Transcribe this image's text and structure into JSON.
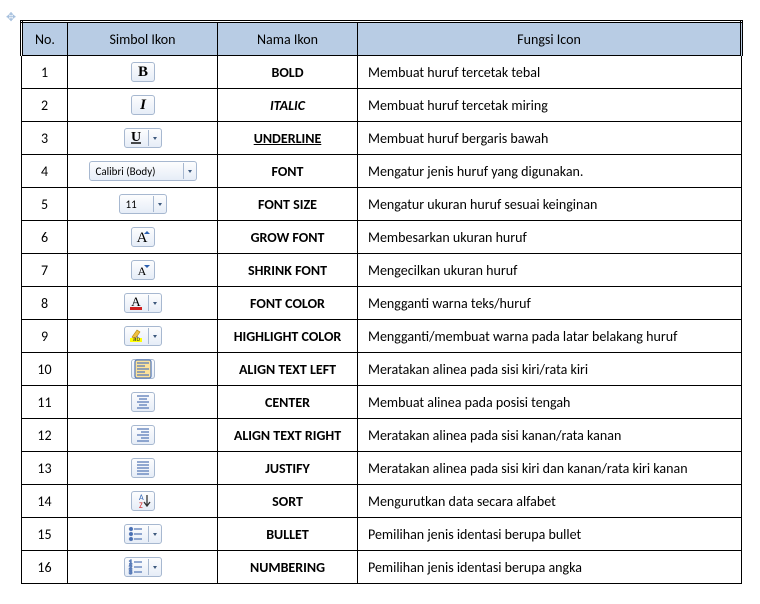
{
  "headers": {
    "no": "No.",
    "symbol": "Simbol Ikon",
    "name": "Nama Ikon",
    "func": "Fungsi Icon"
  },
  "rows": [
    {
      "no": "1",
      "name": "BOLD",
      "func": "Membuat huruf tercetak tebal",
      "nameStyle": ""
    },
    {
      "no": "2",
      "name": "ITALIC",
      "func": "Membuat huruf tercetak miring",
      "nameStyle": "italic"
    },
    {
      "no": "3",
      "name": "UNDERLINE",
      "func": "Membuat huruf bergaris bawah",
      "nameStyle": "underl"
    },
    {
      "no": "4",
      "name": "FONT",
      "func": "Mengatur jenis huruf yang digunakan.",
      "nameStyle": ""
    },
    {
      "no": "5",
      "name": "FONT SIZE",
      "func": "Mengatur ukuran huruf sesuai keinginan",
      "nameStyle": ""
    },
    {
      "no": "6",
      "name": "GROW FONT",
      "func": "Membesarkan ukuran huruf",
      "nameStyle": ""
    },
    {
      "no": "7",
      "name": "SHRINK FONT",
      "func": "Mengecilkan ukuran huruf",
      "nameStyle": ""
    },
    {
      "no": "8",
      "name": "FONT COLOR",
      "func": "Mengganti warna teks/huruf",
      "nameStyle": ""
    },
    {
      "no": "9",
      "name": "HIGHLIGHT COLOR",
      "func": "Mengganti/membuat warna pada latar belakang huruf",
      "nameStyle": ""
    },
    {
      "no": "10",
      "name": "ALIGN TEXT LEFT",
      "func": "Meratakan alinea pada sisi kiri/rata kiri",
      "nameStyle": ""
    },
    {
      "no": "11",
      "name": "CENTER",
      "func": "Membuat alinea pada posisi tengah",
      "nameStyle": ""
    },
    {
      "no": "12",
      "name": "ALIGN TEXT RIGHT",
      "func": "Meratakan alinea pada sisi kanan/rata kanan",
      "nameStyle": ""
    },
    {
      "no": "13",
      "name": "JUSTIFY",
      "func": "Meratakan alinea pada sisi kiri dan kanan/rata kiri kanan",
      "nameStyle": ""
    },
    {
      "no": "14",
      "name": "SORT",
      "func": "Mengurutkan data secara alfabet",
      "nameStyle": ""
    },
    {
      "no": "15",
      "name": "BULLET",
      "func": "Pemilihan jenis identasi berupa bullet",
      "nameStyle": ""
    },
    {
      "no": "16",
      "name": "NUMBERING",
      "func": "Pemilihan jenis identasi berupa angka",
      "nameStyle": ""
    }
  ],
  "font_combo": "Calibri (Body)",
  "size_combo": "11"
}
